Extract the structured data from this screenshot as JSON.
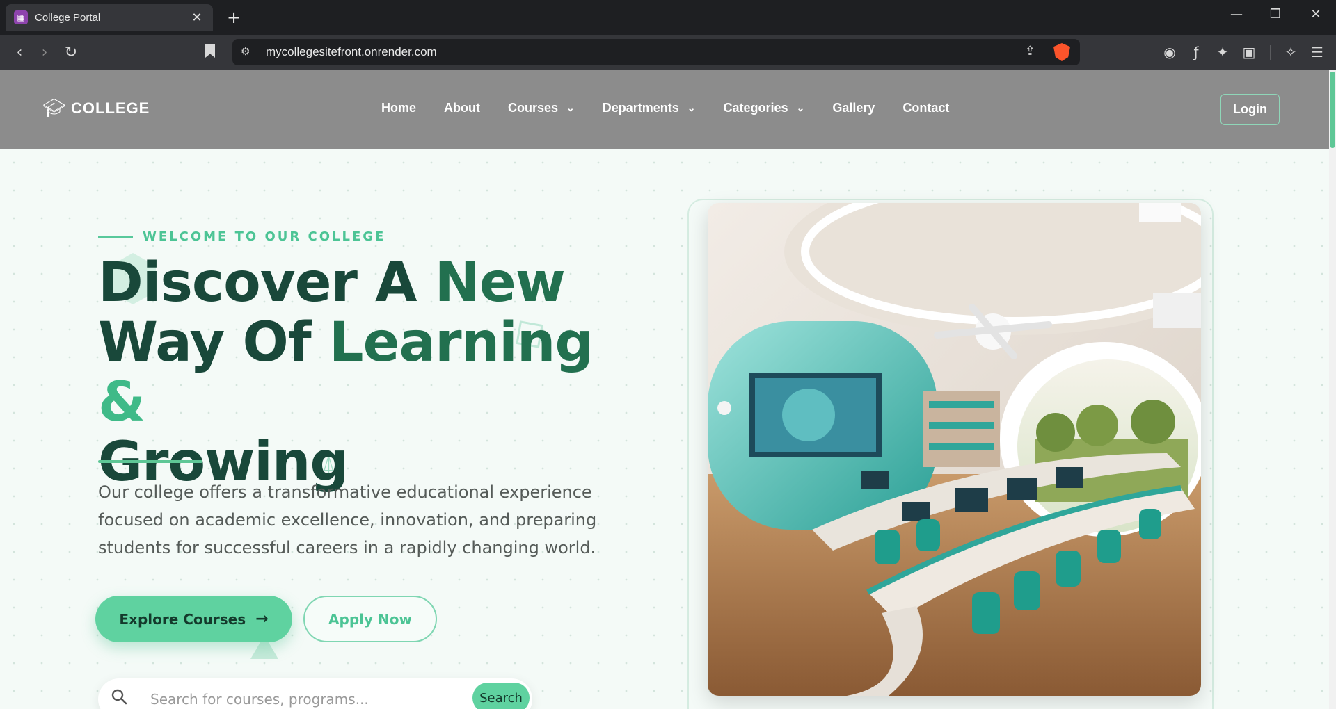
{
  "browser": {
    "tab_title": "College Portal",
    "url": "mycollegesitefront.onrender.com"
  },
  "site": {
    "logo_text": "COLLEGE",
    "nav": [
      {
        "label": "Home"
      },
      {
        "label": "About"
      },
      {
        "label": "Courses"
      },
      {
        "label": "Departments"
      },
      {
        "label": "Categories"
      },
      {
        "label": "Gallery"
      },
      {
        "label": "Contact"
      }
    ],
    "login_label": "Login"
  },
  "hero": {
    "tagline": "WELCOME TO OUR COLLEGE",
    "headline": {
      "part1": "Discover A ",
      "part2": "New",
      "part3": "Way Of ",
      "part4": "Learning ",
      "part5": "&",
      "part6": "Growing"
    },
    "description": "Our college offers a transformative educational experience focused on academic excellence, innovation, and preparing students for successful careers in a rapidly changing world.",
    "explore_label": "Explore Courses",
    "apply_label": "Apply Now",
    "search_placeholder": "Search for courses, programs...",
    "search_button": "Search"
  },
  "icons": {
    "logo": "graduation-cap-icon",
    "search": "search-icon",
    "explore_arrow": "arrow-right-icon"
  },
  "colors": {
    "accent": "#5fd2a0",
    "header_bg": "#8c8c8c",
    "headline_dark": "#19483a",
    "headline_green": "#3fba88"
  }
}
